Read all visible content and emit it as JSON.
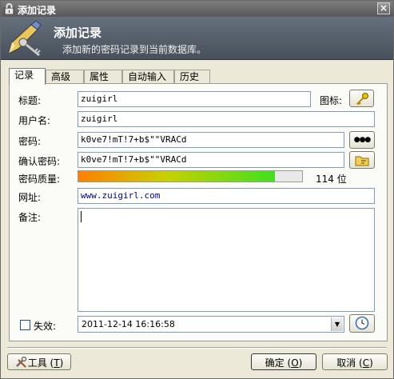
{
  "window": {
    "title": "添加记录",
    "close_glyph": "×"
  },
  "banner": {
    "heading": "添加记录",
    "description": "添加新的密码记录到当前数据库。"
  },
  "tabs": [
    {
      "label": "记录",
      "active": true
    },
    {
      "label": "高级",
      "active": false
    },
    {
      "label": "属性",
      "active": false
    },
    {
      "label": "自动输入",
      "active": false
    },
    {
      "label": "历史",
      "active": false
    }
  ],
  "form": {
    "title_label": "标题:",
    "title_value": "zuigirl",
    "icon_label": "图标:",
    "username_label": "用户名:",
    "username_value": "zuigirl",
    "password_label": "密码:",
    "password_value": "k0ve7!mT!7+b$\"\"VRACd",
    "reveal_glyph": "●●●",
    "confirm_label": "确认密码:",
    "confirm_value": "k0ve7!mT!7+b$\"\"VRACd",
    "quality_label": "密码质量:",
    "quality_fraction": 0.88,
    "quality_bits": "114 位",
    "url_label": "网址:",
    "url_value": "www.zuigirl.com",
    "notes_label": "备注:",
    "notes_value": "",
    "expires_label": "失效:",
    "expires_checked": false,
    "expires_value": "2011-12-14 16:16:58"
  },
  "footer": {
    "tools_label": "工具",
    "tools_hotkey": "T",
    "ok_label": "确定",
    "ok_hotkey": "O",
    "cancel_label": "取消",
    "cancel_hotkey": "C"
  },
  "colors": {
    "window_bg": "#ece9d8",
    "banner_top": "#66707c",
    "quality_start": "#ff8000",
    "quality_end": "#40e020"
  }
}
